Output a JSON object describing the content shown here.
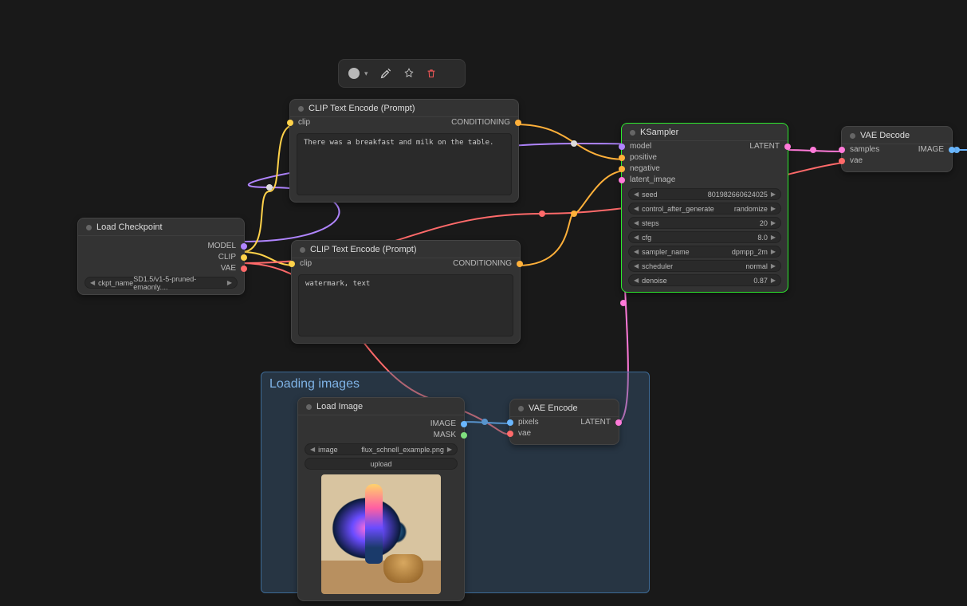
{
  "toolbar": {
    "colorCircle": true
  },
  "group": {
    "title": "Loading images"
  },
  "nodes": {
    "loadCheckpoint": {
      "title": "Load Checkpoint",
      "outputs": {
        "model": "MODEL",
        "clip": "CLIP",
        "vae": "VAE"
      },
      "widget": {
        "label": "ckpt_name",
        "value": "SD1.5/v1-5-pruned-emaonly...."
      }
    },
    "clipPos": {
      "title": "CLIP Text Encode (Prompt)",
      "inputs": {
        "clip": "clip"
      },
      "outputs": {
        "conditioning": "CONDITIONING"
      },
      "text": "There was a breakfast and milk on the table."
    },
    "clipNeg": {
      "title": "CLIP Text Encode (Prompt)",
      "inputs": {
        "clip": "clip"
      },
      "outputs": {
        "conditioning": "CONDITIONING"
      },
      "text": "watermark, text"
    },
    "ksampler": {
      "title": "KSampler",
      "inputs": {
        "model": "model",
        "positive": "positive",
        "negative": "negative",
        "latent_image": "latent_image"
      },
      "outputs": {
        "latent": "LATENT"
      },
      "widgets": {
        "seed": {
          "label": "seed",
          "value": "801982660624025"
        },
        "cag": {
          "label": "control_after_generate",
          "value": "randomize"
        },
        "steps": {
          "label": "steps",
          "value": "20"
        },
        "cfg": {
          "label": "cfg",
          "value": "8.0"
        },
        "sampler": {
          "label": "sampler_name",
          "value": "dpmpp_2m"
        },
        "scheduler": {
          "label": "scheduler",
          "value": "normal"
        },
        "denoise": {
          "label": "denoise",
          "value": "0.87"
        }
      }
    },
    "vaeDecode": {
      "title": "VAE Decode",
      "inputs": {
        "samples": "samples",
        "vae": "vae"
      },
      "outputs": {
        "image": "IMAGE"
      }
    },
    "loadImage": {
      "title": "Load Image",
      "outputs": {
        "image": "IMAGE",
        "mask": "MASK"
      },
      "widget": {
        "label": "image",
        "value": "flux_schnell_example.png"
      },
      "button": "upload"
    },
    "vaeEncode": {
      "title": "VAE Encode",
      "inputs": {
        "pixels": "pixels",
        "vae": "vae"
      },
      "outputs": {
        "latent": "LATENT"
      }
    }
  }
}
